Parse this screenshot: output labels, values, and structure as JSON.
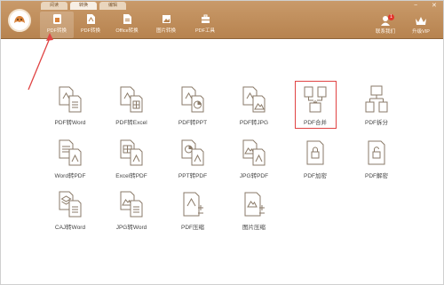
{
  "top_tabs": [
    "阅读",
    "转换",
    "编辑"
  ],
  "toolbar": [
    {
      "label": "PDF转换",
      "icon": "home-convert-icon"
    },
    {
      "label": "PDF转换",
      "icon": "pdf-file-icon"
    },
    {
      "label": "Office转换",
      "icon": "office-file-icon"
    },
    {
      "label": "图片转换",
      "icon": "image-icon"
    },
    {
      "label": "PDF工具",
      "icon": "toolbox-icon"
    }
  ],
  "header_right": {
    "contact_label": "联系我们",
    "contact_badge": "1",
    "upgrade_label": "升级VIP",
    "window_controls": [
      "−",
      "✕"
    ]
  },
  "tiles": [
    {
      "label": "PDF转Word"
    },
    {
      "label": "PDF转Excel"
    },
    {
      "label": "PDF转PPT"
    },
    {
      "label": "PDF转JPG"
    },
    {
      "label": "PDF合并"
    },
    {
      "label": "PDF拆分"
    },
    {
      "label": "Word转PDF"
    },
    {
      "label": "Excel转PDF"
    },
    {
      "label": "PPT转PDF"
    },
    {
      "label": "JPG转PDF"
    },
    {
      "label": "PDF加密"
    },
    {
      "label": "PDF解密"
    },
    {
      "label": "CAJ转Word"
    },
    {
      "label": "JPG转Word"
    },
    {
      "label": "PDF压缩"
    },
    {
      "label": "图片压缩"
    }
  ],
  "colors": {
    "header": "#b7834f",
    "icon_stroke": "#8a7a68",
    "highlight": "#e04343",
    "arrow": "#e04343"
  }
}
